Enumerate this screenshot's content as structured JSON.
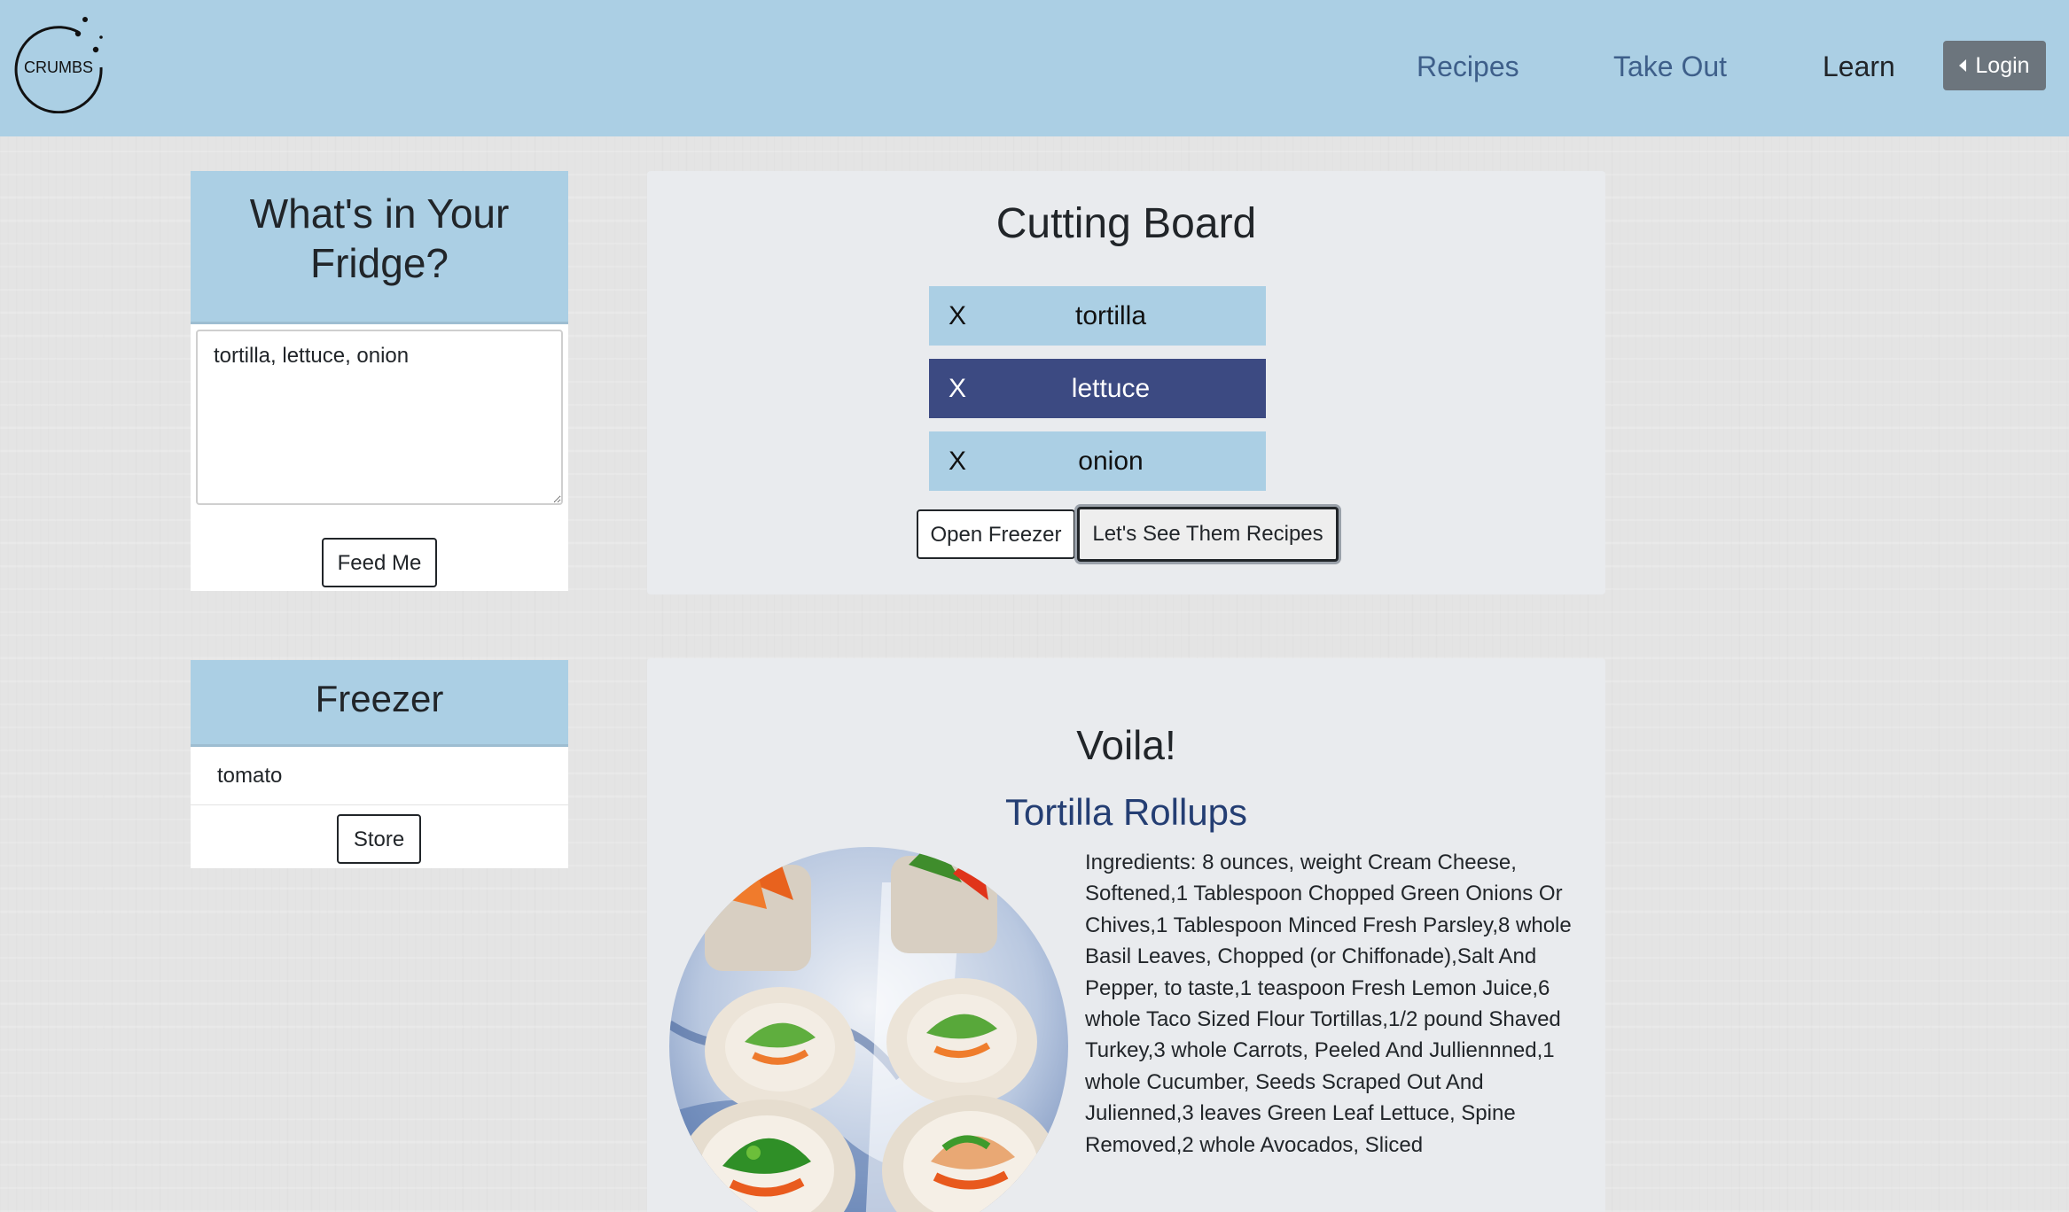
{
  "brand": {
    "logo_text": "CRUMBS"
  },
  "nav": {
    "links": [
      "Recipes",
      "Take Out",
      "Learn"
    ],
    "login_label": "Login"
  },
  "fridge": {
    "title": "What's in Your Fridge?",
    "textarea_value": "tortilla, lettuce, onion",
    "button_label": "Feed Me"
  },
  "freezer": {
    "title": "Freezer",
    "items": [
      "tomato"
    ],
    "button_label": "Store"
  },
  "cutting_board": {
    "title": "Cutting Board",
    "remove_symbol": "X",
    "ingredients": [
      {
        "name": "tortilla",
        "selected": false
      },
      {
        "name": "lettuce",
        "selected": true
      },
      {
        "name": "onion",
        "selected": false
      }
    ],
    "open_freezer_label": "Open Freezer",
    "see_recipes_label": "Let's See Them Recipes"
  },
  "recipe": {
    "heading": "Voila!",
    "title": "Tortilla Rollups",
    "ingredients_text": "Ingredients: 8 ounces, weight Cream Cheese, Softened,1 Tablespoon Chopped Green Onions Or Chives,1 Tablespoon Minced Fresh Parsley,8 whole Basil Leaves, Chopped (or Chiffonade),Salt And Pepper, to taste,1 teaspoon Fresh Lemon Juice,6 whole Taco Sized Flour Tortillas,1/2 pound Shaved Turkey,3 whole Carrots, Peeled And Julliennned,1 whole Cucumber, Seeds Scraped Out And Julienned,3 leaves Green Leaf Lettuce, Spine Removed,2 whole Avocados, Sliced"
  },
  "colors": {
    "header_bg": "#abcfe4",
    "selected_row": "#3c4a82",
    "nav_link": "#3e5f8a",
    "recipe_link": "#243e73"
  }
}
